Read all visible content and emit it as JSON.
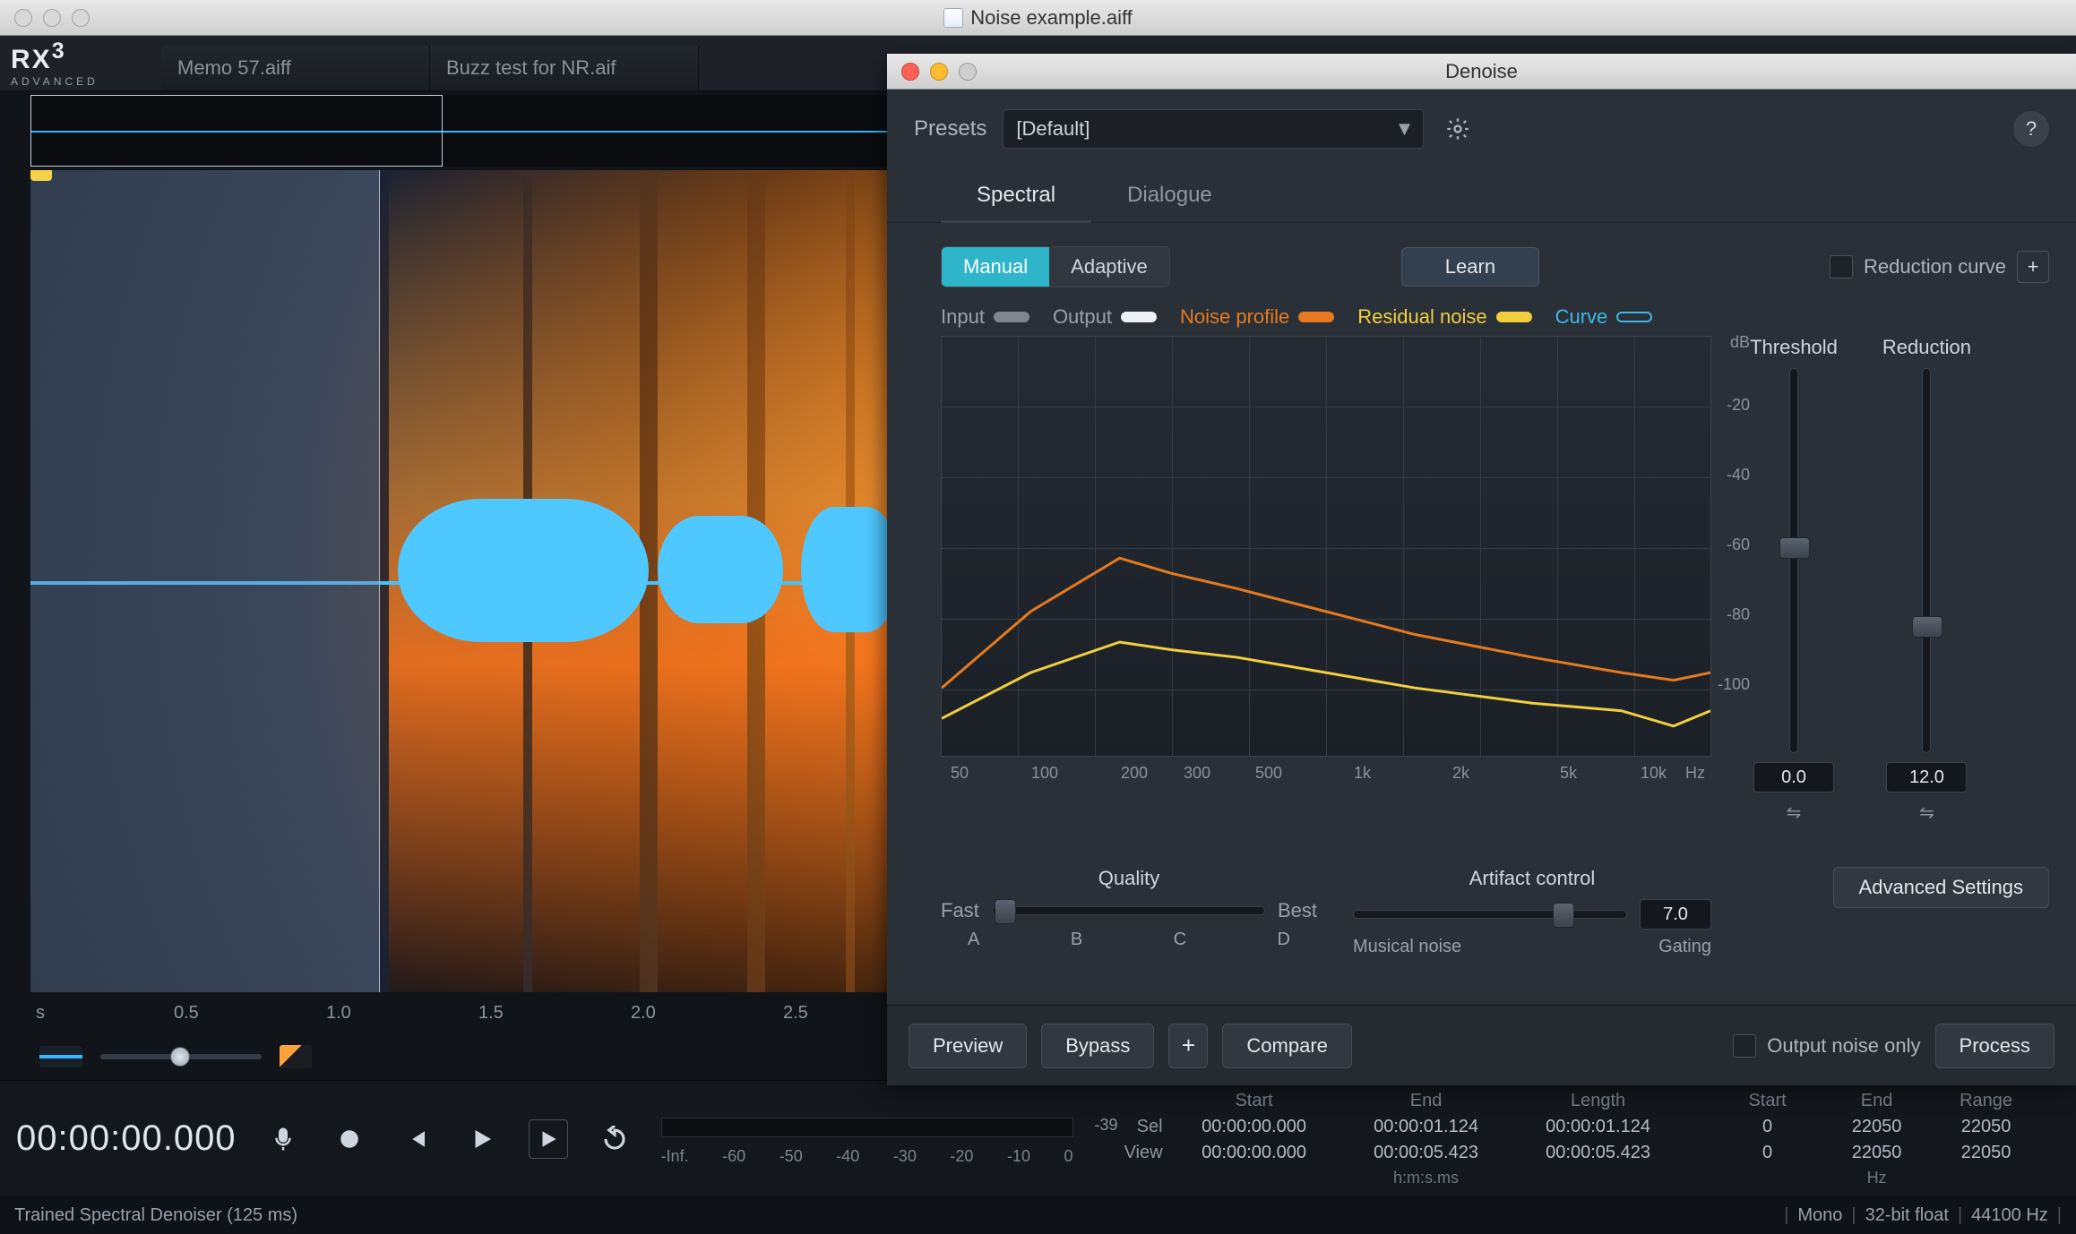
{
  "main_window": {
    "title": "Noise example.aiff",
    "logo": {
      "name": "RX",
      "sup": "3",
      "sub": "ADVANCED"
    },
    "file_tabs": [
      "Memo 57.aiff",
      "Buzz test for NR.aif"
    ],
    "time_axis": {
      "unit": "s",
      "ticks": [
        "0.5",
        "1.0",
        "1.5",
        "2.0",
        "2.5"
      ]
    },
    "zoom_icons": [
      "zoom-in-icon",
      "zoom-out-icon",
      "zoom-sel-icon",
      "zoom-reset-icon",
      "zoom-in-v-icon",
      "zoom-out-v-icon",
      "zoom-region-icon"
    ],
    "transport": {
      "timecode": "00:00:00.000",
      "meter_ticks": [
        "-Inf.",
        "-60",
        "-50",
        "-40",
        "-30",
        "-20",
        "-10",
        "0"
      ],
      "meter_indicator": "-39",
      "ranges": {
        "headers_time": [
          "Start",
          "End",
          "Length"
        ],
        "headers_hz": [
          "Start",
          "End",
          "Range"
        ],
        "sel": {
          "label": "Sel",
          "start": "00:00:00.000",
          "end": "00:00:01.124",
          "length": "00:00:01.124",
          "hz_start": "0",
          "hz_end": "22050",
          "hz_range": "22050"
        },
        "view": {
          "label": "View",
          "start": "00:00:00.000",
          "end": "00:00:05.423",
          "length": "00:00:05.423",
          "hz_start": "0",
          "hz_end": "22050",
          "hz_range": "22050"
        },
        "unit_time": "h:m:s.ms",
        "unit_hz": "Hz"
      }
    },
    "statusbar": {
      "left": "Trained Spectral Denoiser (125 ms)",
      "right": [
        "Mono",
        "32-bit float",
        "44100 Hz"
      ]
    }
  },
  "denoise": {
    "title": "Denoise",
    "presets_label": "Presets",
    "preset_selected": "[Default]",
    "tabs": {
      "spectral": "Spectral",
      "dialogue": "Dialogue",
      "active": "spectral"
    },
    "mode": {
      "manual": "Manual",
      "adaptive": "Adaptive",
      "learn": "Learn"
    },
    "reduction_curve_label": "Reduction curve",
    "legend": {
      "input": {
        "label": "Input",
        "color": "#7e8690"
      },
      "output": {
        "label": "Output",
        "color": "#eef2f6"
      },
      "noise": {
        "label": "Noise profile",
        "color": "#e77a1e"
      },
      "resid": {
        "label": "Residual noise",
        "color": "#f2cf3d"
      },
      "curve": {
        "label": "Curve",
        "color": "#3fb8e6"
      }
    },
    "graph": {
      "y_unit": "dB",
      "y_ticks": [
        "-20",
        "-40",
        "-60",
        "-80",
        "-100"
      ],
      "x_ticks": [
        "50",
        "100",
        "200",
        "300",
        "500",
        "1k",
        "2k",
        "5k",
        "10k"
      ],
      "x_unit": "Hz"
    },
    "sliders": {
      "threshold": {
        "label": "Threshold",
        "value": "0.0"
      },
      "reduction": {
        "label": "Reduction",
        "value": "12.0"
      }
    },
    "quality": {
      "label": "Quality",
      "left": "Fast",
      "right": "Best",
      "letters": [
        "A",
        "B",
        "C",
        "D"
      ]
    },
    "artifact": {
      "label": "Artifact control",
      "left": "Musical noise",
      "right": "Gating",
      "value": "7.0"
    },
    "advanced": "Advanced Settings",
    "bottom": {
      "preview": "Preview",
      "bypass": "Bypass",
      "compare": "Compare",
      "output_noise": "Output noise only",
      "process": "Process"
    }
  },
  "chart_data": {
    "type": "line",
    "xscale": "log",
    "xlabel": "Hz",
    "ylabel": "dB",
    "ylim": [
      -110,
      0
    ],
    "xlim": [
      50,
      20000
    ],
    "x": [
      50,
      100,
      200,
      300,
      500,
      1000,
      2000,
      5000,
      10000,
      15000,
      20000
    ],
    "series": [
      {
        "name": "Noise profile",
        "color": "#e77a1e",
        "values": [
          -92,
          -72,
          -58,
          -62,
          -66,
          -72,
          -78,
          -84,
          -88,
          -90,
          -88
        ]
      },
      {
        "name": "Residual noise",
        "color": "#f2cf3d",
        "values": [
          -100,
          -88,
          -80,
          -82,
          -84,
          -88,
          -92,
          -96,
          -98,
          -102,
          -98
        ]
      }
    ]
  }
}
